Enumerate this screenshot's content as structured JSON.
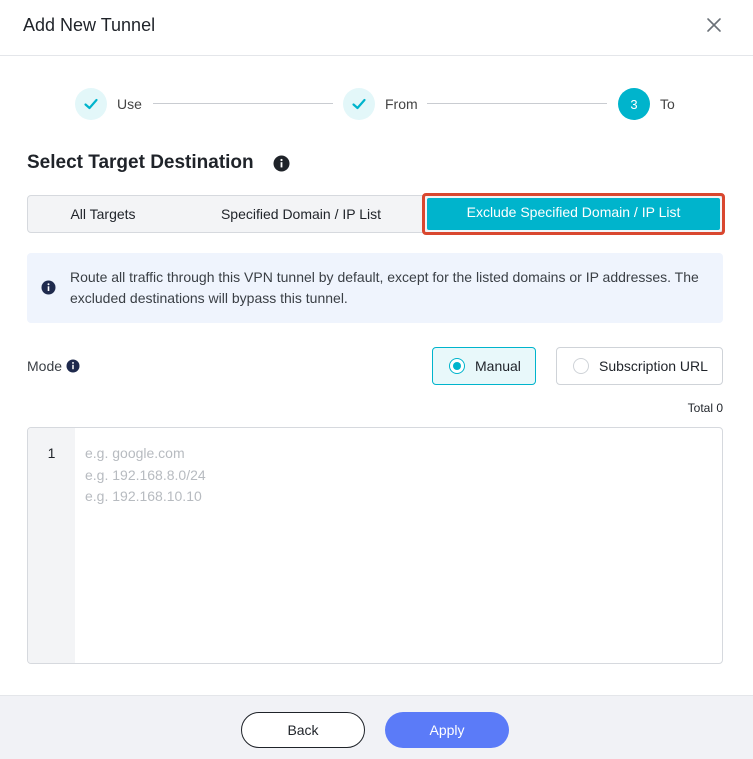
{
  "dialog": {
    "title": "Add New Tunnel",
    "close_icon": "close-icon"
  },
  "steps": [
    {
      "label": "Use",
      "state": "done",
      "icon": "check-icon"
    },
    {
      "label": "From",
      "state": "done",
      "icon": "check-icon"
    },
    {
      "label": "To",
      "state": "active",
      "number": "3"
    }
  ],
  "section": {
    "title": "Select Target Destination",
    "info_icon": "info-icon"
  },
  "target_tabs": [
    {
      "label": "All Targets",
      "selected": false
    },
    {
      "label": "Specified Domain / IP List",
      "selected": false
    },
    {
      "label": "Exclude Specified Domain / IP List",
      "selected": true
    }
  ],
  "notice": {
    "icon": "info-icon",
    "text": "Route all traffic through this VPN tunnel by default, except for the listed domains or IP addresses. The excluded destinations will bypass this tunnel."
  },
  "mode": {
    "label": "Mode",
    "options": [
      {
        "label": "Manual",
        "selected": true
      },
      {
        "label": "Subscription URL",
        "selected": false
      }
    ]
  },
  "total_label": "Total 0",
  "editor": {
    "line_number": "1",
    "value": "",
    "placeholder": "e.g. google.com\ne.g. 192.168.8.0/24\ne.g. 192.168.10.10"
  },
  "footer": {
    "back_label": "Back",
    "apply_label": "Apply"
  },
  "colors": {
    "accent": "#00b4cc",
    "primary_button": "#5b7bf8",
    "highlight_border": "#d9472f",
    "notice_bg": "#eff4fd"
  }
}
